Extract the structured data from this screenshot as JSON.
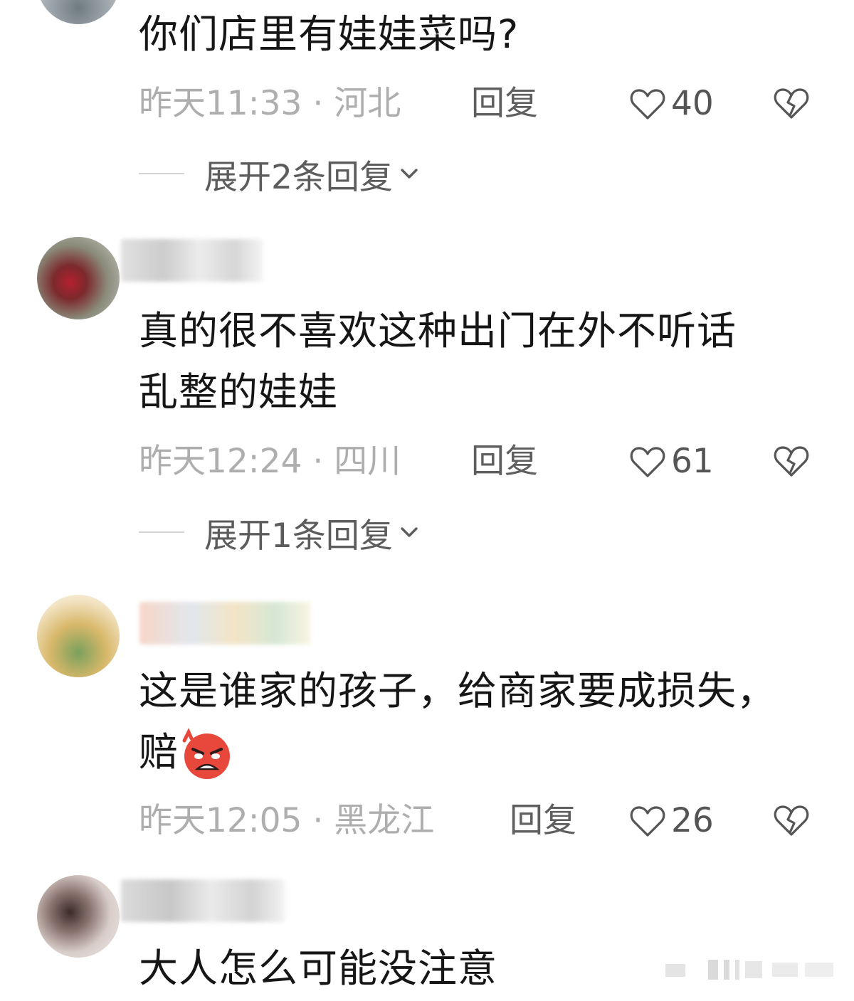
{
  "comments": [
    {
      "text": "你们店里有娃娃菜吗?",
      "meta": "昨天11:33 · 河北",
      "reply": "回复",
      "likes": "40",
      "expand": "展开2条回复"
    },
    {
      "text_line1": "真的很不喜欢这种出门在外不听话",
      "text_line2": "乱整的娃娃",
      "meta": "昨天12:24 · 四川",
      "reply": "回复",
      "likes": "61",
      "expand": "展开1条回复"
    },
    {
      "text_line1": "这是谁家的孩子，给商家要成损失，",
      "text_line2": "赔",
      "emoji": "angry-face-emoji",
      "meta": "昨天12:05 · 黑龙江",
      "reply": "回复",
      "likes": "26"
    },
    {
      "text": "大人怎么可能没注意"
    }
  ],
  "icons": {
    "like": "heart-outline-icon",
    "dislike": "broken-heart-icon",
    "expand": "chevron-down-icon"
  },
  "colors": {
    "text": "#161616",
    "meta": "#aeaeae",
    "action": "#5f5f5f",
    "emoji_red": "#e8473c"
  }
}
